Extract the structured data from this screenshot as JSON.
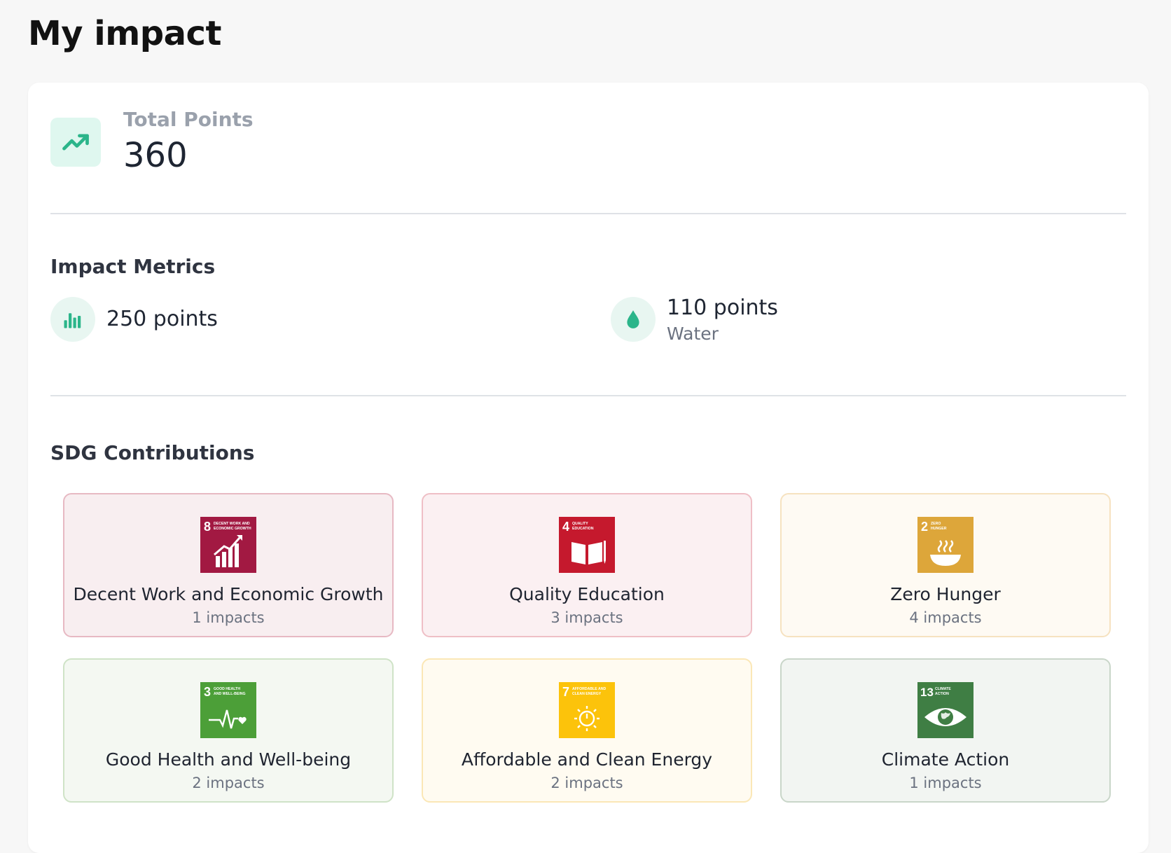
{
  "page": {
    "title": "My impact"
  },
  "total": {
    "label": "Total Points",
    "value": "360",
    "icon": "trending-up-icon"
  },
  "metrics": {
    "title": "Impact Metrics",
    "items": [
      {
        "value": "250 points",
        "label": "",
        "icon": "bar-chart-icon"
      },
      {
        "value": "110 points",
        "label": "Water",
        "icon": "water-drop-icon"
      }
    ]
  },
  "sdg": {
    "title": "SDG Contributions",
    "items": [
      {
        "number": "8",
        "caption_line1": "DECENT WORK AND",
        "caption_line2": "ECONOMIC GROWTH",
        "name": "Decent Work and Economic Growth",
        "count": "1 impacts",
        "color": "#A21942",
        "tint": "#f8eef0",
        "border": "#e7b9c3",
        "icon": "growth-chart-icon"
      },
      {
        "number": "4",
        "caption_line1": "QUALITY",
        "caption_line2": "EDUCATION",
        "name": "Quality Education",
        "count": "3 impacts",
        "color": "#C5192D",
        "tint": "#fbf0f2",
        "border": "#efbfc6",
        "icon": "book-icon"
      },
      {
        "number": "2",
        "caption_line1": "ZERO",
        "caption_line2": "HUNGER",
        "name": "Zero Hunger",
        "count": "4 impacts",
        "color": "#DDA63A",
        "tint": "#fefaf3",
        "border": "#f6e2c0",
        "icon": "bowl-icon"
      },
      {
        "number": "3",
        "caption_line1": "GOOD HEALTH",
        "caption_line2": "AND WELL-BEING",
        "name": "Good Health and Well-being",
        "count": "2 impacts",
        "color": "#4C9F38",
        "tint": "#f4f8f2",
        "border": "#cfe3c7",
        "icon": "heartbeat-icon"
      },
      {
        "number": "7",
        "caption_line1": "AFFORDABLE AND",
        "caption_line2": "CLEAN ENERGY",
        "name": "Affordable and Clean Energy",
        "count": "2 impacts",
        "color": "#FCC30B",
        "tint": "#fffbf1",
        "border": "#fbe7b6",
        "icon": "sun-power-icon"
      },
      {
        "number": "13",
        "caption_line1": "CLIMATE",
        "caption_line2": "ACTION",
        "name": "Climate Action",
        "count": "1 impacts",
        "color": "#3F7E44",
        "tint": "#f2f5f2",
        "border": "#c9d6c9",
        "icon": "eye-globe-icon"
      }
    ]
  },
  "colors": {
    "accent": "#2bb58a",
    "accent_bg": "#dff7ef"
  }
}
